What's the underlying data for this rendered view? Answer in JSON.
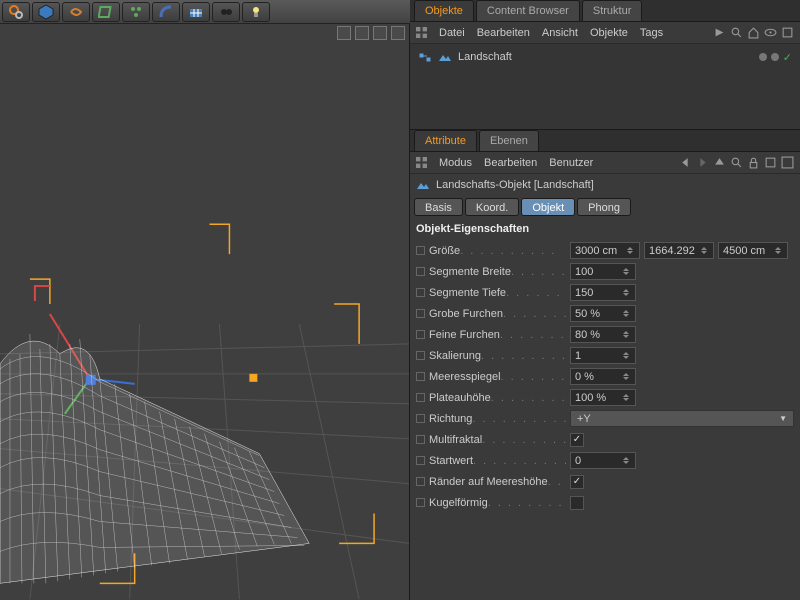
{
  "toolbar": {
    "icons": [
      "gears",
      "cube",
      "chain",
      "deformer",
      "particles",
      "bend",
      "grid",
      "camera",
      "light"
    ]
  },
  "objects_panel": {
    "tabs": [
      "Objekte",
      "Content Browser",
      "Struktur"
    ],
    "active_tab": 0,
    "menu": [
      "Datei",
      "Bearbeiten",
      "Ansicht",
      "Objekte",
      "Tags"
    ],
    "tree": [
      {
        "name": "Landschaft"
      }
    ]
  },
  "attributes_panel": {
    "tabs": [
      "Attribute",
      "Ebenen"
    ],
    "active_tab": 0,
    "menu": [
      "Modus",
      "Bearbeiten",
      "Benutzer"
    ],
    "header": "Landschafts-Objekt [Landschaft]",
    "subtabs": [
      "Basis",
      "Koord.",
      "Objekt",
      "Phong"
    ],
    "active_subtab": 2,
    "section_title": "Objekt-Eigenschaften",
    "size": {
      "label": "Größe",
      "x": "3000 cm",
      "y": "1664.292",
      "z": "4500 cm"
    },
    "rows": [
      {
        "label": "Segmente Breite",
        "value": "100",
        "type": "num"
      },
      {
        "label": "Segmente Tiefe",
        "value": "150",
        "type": "num"
      },
      {
        "label": "Grobe Furchen",
        "value": "50 %",
        "type": "num"
      },
      {
        "label": "Feine Furchen",
        "value": "80 %",
        "type": "num"
      },
      {
        "label": "Skalierung",
        "value": "1",
        "type": "num"
      },
      {
        "label": "Meeresspiegel",
        "value": "0 %",
        "type": "num"
      },
      {
        "label": "Plateauhöhe",
        "value": "100 %",
        "type": "num"
      },
      {
        "label": "Richtung",
        "value": "+Y",
        "type": "drop"
      },
      {
        "label": "Multifraktal",
        "value": true,
        "type": "check"
      },
      {
        "label": "Startwert",
        "value": "0",
        "type": "num"
      },
      {
        "label": "Ränder auf Meereshöhe",
        "value": true,
        "type": "check"
      },
      {
        "label": "Kugelförmig",
        "value": false,
        "type": "check"
      }
    ]
  }
}
